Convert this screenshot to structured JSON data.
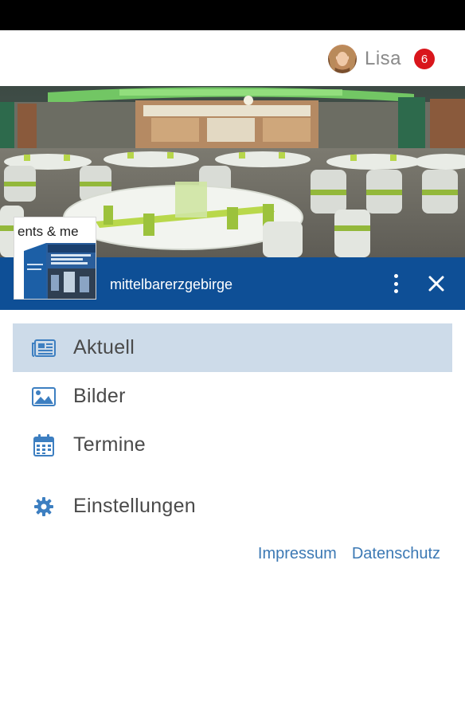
{
  "header": {
    "user_name": "Lisa",
    "notification_count": "6",
    "avatar_icon": "user-avatar"
  },
  "banner": {
    "thumbnail_text": "ents & me",
    "title": "mittelbarerzgebirge",
    "more_icon": "more-vertical-icon",
    "close_icon": "close-icon"
  },
  "menu": {
    "items": [
      {
        "label": "Aktuell",
        "icon": "newspaper-icon",
        "active": true
      },
      {
        "label": "Bilder",
        "icon": "image-icon",
        "active": false
      },
      {
        "label": "Termine",
        "icon": "calendar-icon",
        "active": false
      },
      {
        "label": "Einstellungen",
        "icon": "gear-icon",
        "active": false
      }
    ]
  },
  "footer": {
    "impressum": "Impressum",
    "datenschutz": "Datenschutz"
  },
  "colors": {
    "title_bar": "#0e4f96",
    "active_item": "#cddbe9",
    "icon_blue": "#3d7fc1",
    "link_blue": "#3c79b4",
    "badge_red": "#d9161c"
  }
}
